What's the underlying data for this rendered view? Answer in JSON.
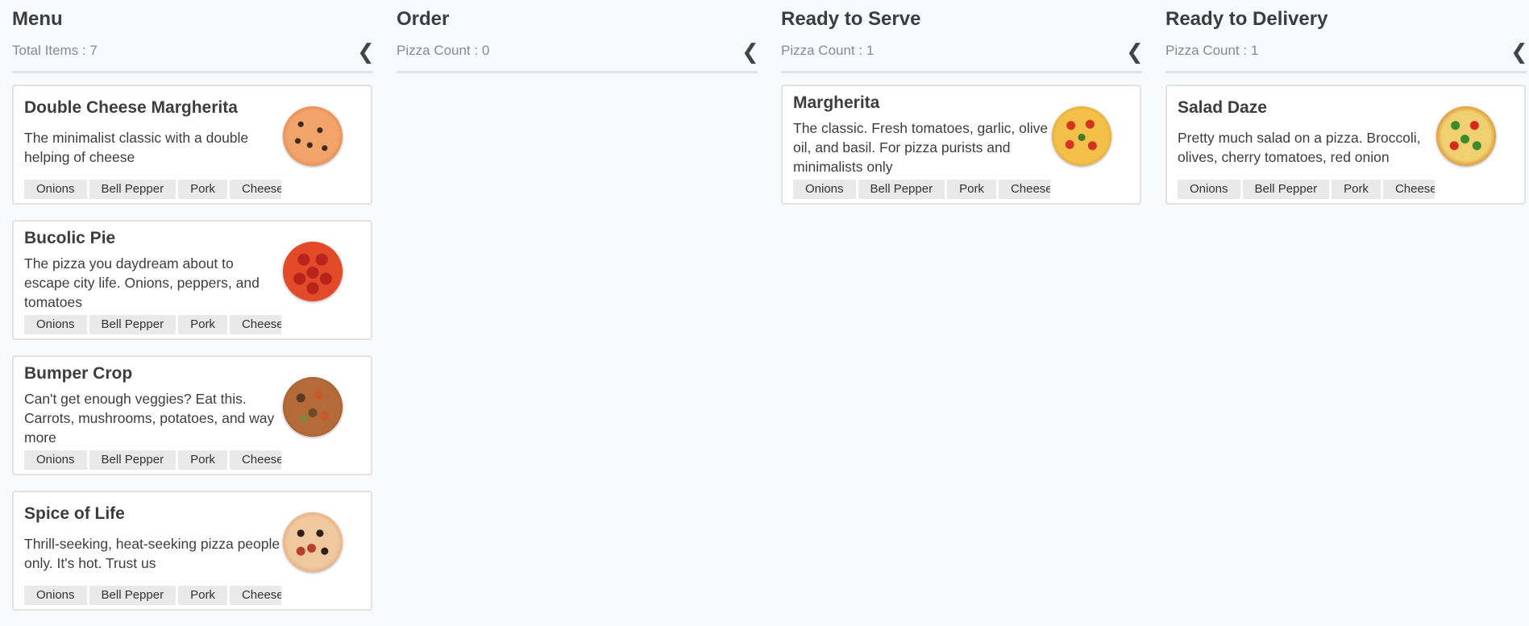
{
  "columns": [
    {
      "title": "Menu",
      "subtitle": "Total Items : 7",
      "cards": [
        {
          "title": "Double Cheese Margherita",
          "description": "The minimalist classic with a double helping of cheese",
          "image": "pizza-cheese",
          "tags": [
            "Onions",
            "Bell Pepper",
            "Pork",
            "Cheese"
          ]
        },
        {
          "title": "Bucolic Pie",
          "description": "The pizza you daydream about to escape city life. Onions, peppers, and tomatoes",
          "image": "pizza-pepperoni",
          "tags": [
            "Onions",
            "Bell Pepper",
            "Pork",
            "Cheese"
          ]
        },
        {
          "title": "Bumper Crop",
          "description": "Can't get enough veggies? Eat this. Carrots, mushrooms, potatoes, and way more",
          "image": "pizza-veggie",
          "tags": [
            "Onions",
            "Bell Pepper",
            "Pork",
            "Cheese"
          ]
        },
        {
          "title": "Spice of Life",
          "description": "Thrill-seeking, heat-seeking pizza people only.  It's hot. Trust us",
          "image": "pizza-spice",
          "tags": [
            "Onions",
            "Bell Pepper",
            "Pork",
            "Cheese"
          ]
        }
      ]
    },
    {
      "title": "Order",
      "subtitle": "Pizza Count : 0",
      "cards": []
    },
    {
      "title": "Ready to Serve",
      "subtitle": "Pizza Count : 1",
      "cards": [
        {
          "title": "Margherita",
          "description": "The classic. Fresh tomatoes, garlic, olive oil, and basil. For pizza purists and minimalists only",
          "image": "pizza-margherita",
          "tags": [
            "Onions",
            "Bell Pepper",
            "Pork",
            "Cheese"
          ]
        }
      ]
    },
    {
      "title": "Ready to Delivery",
      "subtitle": "Pizza Count : 1",
      "cards": [
        {
          "title": "Salad Daze",
          "description": "Pretty much salad on a pizza. Broccoli, olives, cherry tomatoes, red onion",
          "image": "pizza-salad",
          "tags": [
            "Onions",
            "Bell Pepper",
            "Pork",
            "Cheese"
          ]
        }
      ]
    }
  ],
  "icons": {
    "collapse": "chevron-left-icon"
  }
}
